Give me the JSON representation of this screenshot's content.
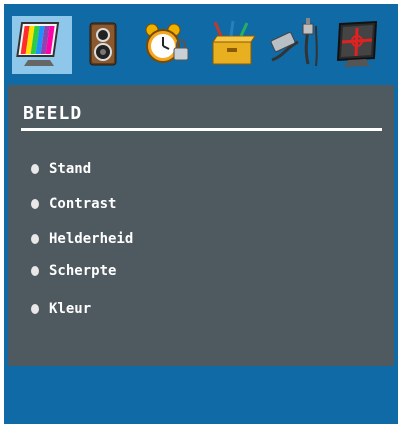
{
  "icons": [
    {
      "name": "picture-tv-icon",
      "selected": true
    },
    {
      "name": "speaker-icon",
      "selected": false
    },
    {
      "name": "alarm-clock-icon",
      "selected": false
    },
    {
      "name": "toolbox-icon",
      "selected": false
    },
    {
      "name": "scart-cable-icon",
      "selected": false
    },
    {
      "name": "source-screen-icon",
      "selected": false
    }
  ],
  "menu": {
    "title": "BEELD",
    "items": [
      {
        "label": "Stand"
      },
      {
        "label": "Contrast"
      },
      {
        "label": "Helderheid"
      },
      {
        "label": "Scherpte"
      },
      {
        "label": "Kleur"
      }
    ]
  },
  "colors": {
    "background_blue": "#0f6aa6",
    "panel_gray": "#4f5a60",
    "selected_tile": "#8fc7eb",
    "text": "#ffffff"
  }
}
